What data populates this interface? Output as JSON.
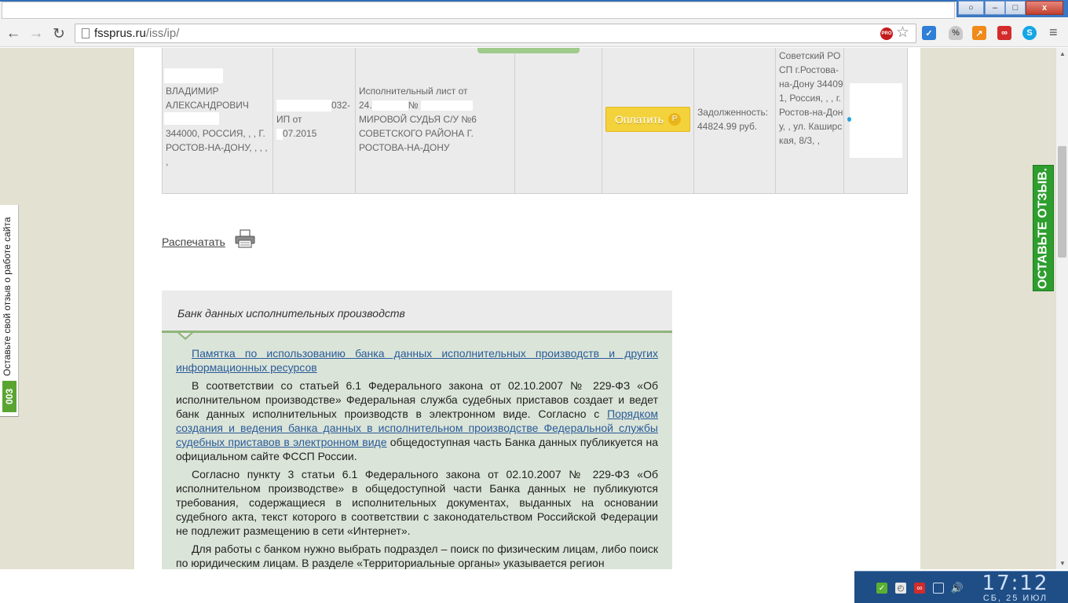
{
  "browser": {
    "window_controls": {
      "user": "○",
      "minimize": "–",
      "maximize": "□",
      "close": "x"
    },
    "nav": {
      "back": "←",
      "forward": "→",
      "reload": "↻"
    },
    "url_host": "fssprus.ru",
    "url_path": "/iss/ip/",
    "pro_badge": "PRO",
    "star": "☆",
    "menu": "≡"
  },
  "result_row": {
    "debtor_name_line1": "ВЛАДИМИР",
    "debtor_name_line2": "АЛЕКСАНДРОВИЧ",
    "debtor_address": "344000, РОССИЯ, , , Г. РОСТОВ-НА-ДОНУ, , , , ,",
    "proceeding_suffix": "032-",
    "proceeding_label": "ИП от",
    "proceeding_date_suffix": "07.2015",
    "doc_line1": "Исполнительный лист от",
    "doc_date_prefix": "24.",
    "doc_number_symbol": "№",
    "doc_issuer": "МИРОВОЙ СУДЬЯ С/У №6 СОВЕТСКОГО РАЙОНА Г. РОСТОВА-НА-ДОНУ",
    "pay_button": "Оплатить",
    "ruble_symbol": "Р",
    "debt_label": "Задолженность:",
    "debt_amount": "44824.99 руб.",
    "department": "Советский РОСП г.Ростова-на-Дону 344091, Россия, , , г. Ростов-на-Дону, , ул. Каширская, 8/3, ,"
  },
  "print": {
    "label": "Распечатать"
  },
  "info_panel": {
    "title": "Банк данных исполнительных производств",
    "memo_link": "Памятка по использованию банка данных исполнительных производств и других информационных ресурсов",
    "p1_start": "В соответствии со статьей 6.1 Федерального закона от 02.10.2007 № 229-ФЗ «Об исполнительном производстве» Федеральная служба судебных приставов создает и ведет банк данных исполнительных производств в электронном виде. Согласно с ",
    "p1_link": "Порядком создания и ведения банка данных в исполнительном производстве Федеральной службы судебных приставов в электронном виде",
    "p1_end": " общедоступная часть Банка данных публикуется на официальном сайте ФССП России.",
    "p2": "Согласно пункту 3 статьи 6.1 Федерального закона от 02.10.2007 № 229-ФЗ «Об исполнительном производстве» в общедоступной части Банка данных не публикуются требования, содержащиеся в исполнительных документах, выданных на основании судебного акта, текст которого в соответствии с законодательством Российской Федерации не подлежит размещению в сети «Интернет».",
    "p3": "Для работы с банком нужно выбрать подраздел – поиск по физическим лицам, либо поиск по юридическим лицам. В разделе «Территориальные органы» указывается регион"
  },
  "feedback_left": {
    "text": "Оставьте свой отзыв о работе сайта",
    "count": "003"
  },
  "feedback_right": {
    "text": "ОСТАВЬТЕ ОТЗЫВ."
  },
  "taskbar": {
    "time": "17:12",
    "date": "СБ, 25  ИЮЛ"
  }
}
